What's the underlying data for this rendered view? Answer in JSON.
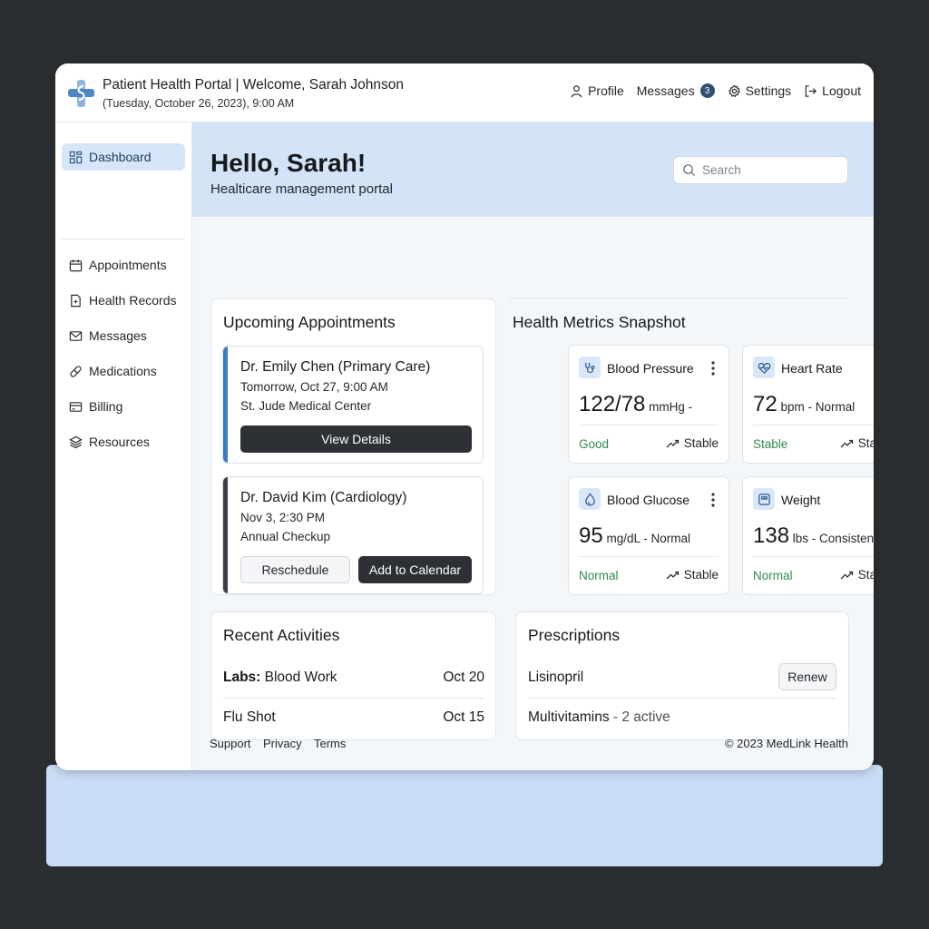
{
  "header": {
    "title": "Patient Health Portal | Welcome, Sarah Johnson",
    "datetime": "(Tuesday, October 26, 2023), 9:00 AM",
    "nav": {
      "profile": "Profile",
      "messages": "Messages",
      "messages_count": "3",
      "settings": "Settings",
      "logout": "Logout"
    }
  },
  "sidebar": {
    "items": [
      {
        "label": "Dashboard",
        "icon": "dashboard-icon",
        "active": true
      },
      {
        "label": "Appointments",
        "icon": "calendar-icon"
      },
      {
        "label": "Health Records",
        "icon": "file-icon"
      },
      {
        "label": "Messages",
        "icon": "mail-icon"
      },
      {
        "label": "Medications",
        "icon": "pill-icon"
      },
      {
        "label": "Billing",
        "icon": "credit-card-icon"
      },
      {
        "label": "Resources",
        "icon": "layers-icon"
      }
    ]
  },
  "hero": {
    "greeting": "Hello, Sarah!",
    "subtitle": "Healticare management portal",
    "search_placeholder": "Search"
  },
  "appointments": {
    "title": "Upcoming Appointments",
    "items": [
      {
        "doctor": "Dr. Emily Chen (Primary Care)",
        "when": "Tomorrow, Oct 27, 9:00 AM",
        "where": "St. Jude Medical Center",
        "primary_action": "View Details",
        "accent": "#3b7cc4"
      },
      {
        "doctor": "Dr. David Kim (Cardiology)",
        "when": "Nov 3, 2:30 PM",
        "where": "Annual Checkup",
        "secondary_action": "Reschedule",
        "primary_action": "Add to Calendar",
        "accent": "#3a3f46"
      }
    ]
  },
  "metrics": {
    "title": "Health Metrics Snapshot",
    "cards": [
      {
        "name": "Blood Pressure",
        "icon": "stethoscope-icon",
        "value": "122/78",
        "unit": " mmHg -",
        "status": "Good",
        "trend": "Stable"
      },
      {
        "name": "Heart Rate",
        "icon": "heart-pulse-icon",
        "value": "72",
        "unit": " bpm - Normal",
        "status": "Stable",
        "trend": "Stable"
      },
      {
        "name": "Blood Glucose",
        "icon": "droplet-icon",
        "value": "95",
        "unit": " mg/dL - Normal",
        "status": "Normal",
        "trend": "Stable"
      },
      {
        "name": "Weight",
        "icon": "scale-icon",
        "value": "138",
        "unit": " lbs - Consistent",
        "status": "Normal",
        "trend": "Stable"
      }
    ]
  },
  "activities": {
    "title": "Recent Activities",
    "items": [
      {
        "label_bold": "Labs:",
        "label": " Blood Work",
        "date": "Oct 20"
      },
      {
        "label_bold": "",
        "label": "Flu Shot",
        "date": "Oct 15"
      }
    ]
  },
  "prescriptions": {
    "title": "Prescriptions",
    "items": [
      {
        "name": "Lisinopril",
        "action": "Renew"
      },
      {
        "name": "Multivitamins",
        "note": " - 2 active"
      }
    ]
  },
  "footer": {
    "links": [
      "Support",
      "Privacy",
      "Terms"
    ],
    "copyright": "© 2023 MedLink Health"
  },
  "colors": {
    "accent": "#3b7cc4",
    "hero_bg": "#d3e3f8",
    "status_green": "#2f8a4f",
    "dark_button": "#2d3035"
  }
}
